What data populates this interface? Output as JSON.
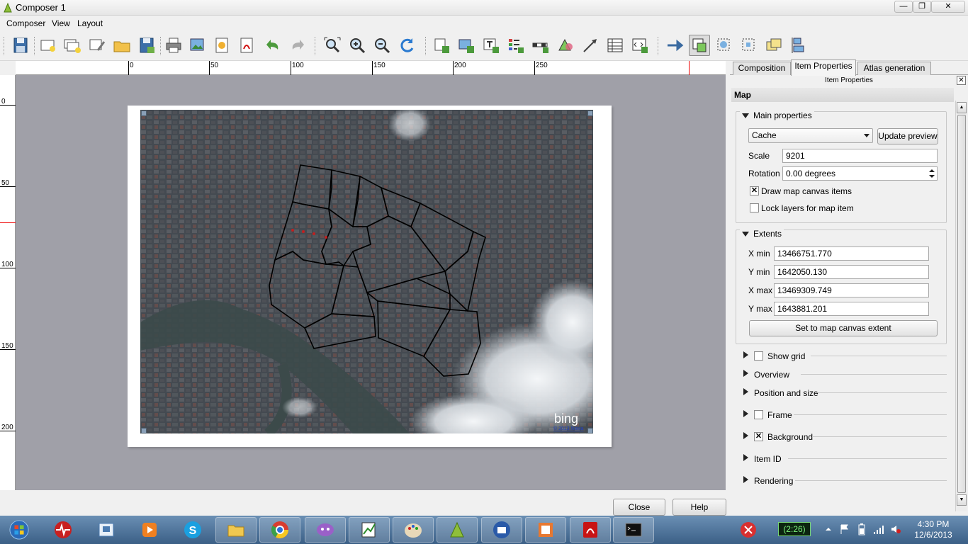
{
  "window": {
    "title": "Composer 1",
    "minimize": "—",
    "maximize": "❐",
    "close": "✕"
  },
  "menu": {
    "composer": "Composer",
    "view": "View",
    "layout": "Layout"
  },
  "ruler": {
    "h_labels": [
      "0",
      "50",
      "100",
      "150",
      "200",
      "250"
    ],
    "v_labels": [
      "0",
      "50",
      "100",
      "150",
      "200"
    ]
  },
  "map": {
    "watermark": "bing",
    "copyright": "© 2013 Nokia"
  },
  "buttons": {
    "close": "Close",
    "help": "Help"
  },
  "dock": {
    "tabs": [
      "Composition",
      "Item Properties",
      "Atlas generation"
    ],
    "active_tab": "Item Properties",
    "title": "Item Properties",
    "section": "Map",
    "main_properties": {
      "title": "Main properties",
      "preview_mode": "Cache",
      "update_preview": "Update preview",
      "scale_label": "Scale",
      "scale_value": "9201",
      "rotation_label": "Rotation",
      "rotation_value": "0.00 degrees",
      "draw_canvas_items": "Draw map canvas items",
      "draw_canvas_items_checked": true,
      "lock_layers": "Lock layers for map item",
      "lock_layers_checked": false
    },
    "extents": {
      "title": "Extents",
      "xmin_label": "X min",
      "xmin": "13466751.770",
      "ymin_label": "Y min",
      "ymin": "1642050.130",
      "xmax_label": "X max",
      "xmax": "13469309.749",
      "ymax_label": "Y max",
      "ymax": "1643881.201",
      "set_extent": "Set to map canvas extent"
    },
    "collapsed_groups": {
      "show_grid": "Show grid",
      "overview": "Overview",
      "position_size": "Position and size",
      "frame": "Frame",
      "background": "Background",
      "item_id": "Item ID",
      "rendering": "Rendering"
    },
    "background_checked": true,
    "frame_checked": false,
    "show_grid_checked": false
  },
  "taskbar": {
    "battery_timer": "(2:26)",
    "time": "4:30 PM",
    "date": "12/6/2013"
  },
  "colors": {
    "taskbar": "#3b5f86",
    "canvas": "#a0a0a8",
    "polygon": "#000000"
  }
}
